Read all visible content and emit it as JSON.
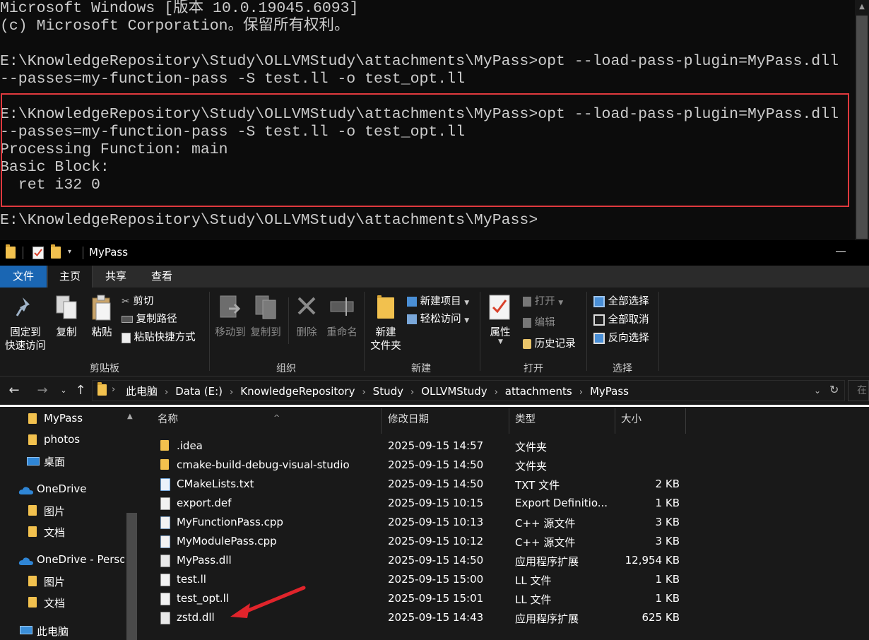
{
  "terminal": {
    "lines": [
      "Microsoft Windows [版本 10.0.19045.6093]",
      "(c) Microsoft Corporation。保留所有权利。",
      "",
      "E:\\KnowledgeRepository\\Study\\OLLVMStudy\\attachments\\MyPass>opt --load-pass-plugin=MyPass.dll",
      "--passes=my-function-pass -S test.ll -o test_opt.ll",
      "",
      "E:\\KnowledgeRepository\\Study\\OLLVMStudy\\attachments\\MyPass>opt --load-pass-plugin=MyPass.dll",
      "--passes=my-function-pass -S test.ll -o test_opt.ll",
      "Processing Function: main",
      "Basic Block:",
      "  ret i32 0",
      "",
      "E:\\KnowledgeRepository\\Study\\OLLVMStudy\\attachments\\MyPass>"
    ],
    "highlight_color": "#e0393e"
  },
  "explorer": {
    "title": "MyPass",
    "tabs": {
      "file": "文件",
      "home": "主页",
      "share": "共享",
      "view": "查看"
    },
    "ribbon": {
      "clipboard": {
        "label": "剪贴板",
        "pin_line1": "固定到",
        "pin_line2": "快速访问",
        "copy": "复制",
        "paste": "粘贴",
        "cut": "剪切",
        "copy_path": "复制路径",
        "paste_shortcut": "粘贴快捷方式"
      },
      "organize": {
        "label": "组织",
        "move_to": "移动到",
        "copy_to": "复制到",
        "delete": "删除",
        "rename": "重命名"
      },
      "new": {
        "label": "新建",
        "new_folder_line1": "新建",
        "new_folder_line2": "文件夹",
        "new_item": "新建项目",
        "easy_access": "轻松访问"
      },
      "open": {
        "label": "打开",
        "properties": "属性",
        "open": "打开",
        "edit": "编辑",
        "history": "历史记录"
      },
      "select": {
        "label": "选择",
        "select_all": "全部选择",
        "select_none": "全部取消",
        "invert": "反向选择"
      }
    },
    "breadcrumbs": [
      "此电脑",
      "Data (E:)",
      "KnowledgeRepository",
      "Study",
      "OLLVMStudy",
      "attachments",
      "MyPass"
    ],
    "search_placeholder": "在",
    "nav": [
      {
        "label": "MyPass",
        "icon": "folder-icon"
      },
      {
        "label": "photos",
        "icon": "folder-icon"
      },
      {
        "label": "桌面",
        "icon": "desktop-icon"
      },
      {
        "label": "OneDrive",
        "icon": "onedrive-icon"
      },
      {
        "label": "图片",
        "icon": "folder-icon"
      },
      {
        "label": "文档",
        "icon": "folder-icon"
      },
      {
        "label": "OneDrive - Perso",
        "icon": "onedrive-icon"
      },
      {
        "label": "图片",
        "icon": "folder-icon"
      },
      {
        "label": "文档",
        "icon": "folder-icon"
      },
      {
        "label": "此电脑",
        "icon": "computer-icon"
      }
    ],
    "columns": {
      "name": "名称",
      "modified": "修改日期",
      "type": "类型",
      "size": "大小"
    },
    "files": [
      {
        "name": ".idea",
        "modified": "2025-09-15 14:57",
        "type": "文件夹",
        "size": "",
        "icon": "folder-icon"
      },
      {
        "name": "cmake-build-debug-visual-studio",
        "modified": "2025-09-15 14:50",
        "type": "文件夹",
        "size": "",
        "icon": "folder-icon"
      },
      {
        "name": "CMakeLists.txt",
        "modified": "2025-09-15 14:50",
        "type": "TXT 文件",
        "size": "2 KB",
        "icon": "text-file-icon"
      },
      {
        "name": "export.def",
        "modified": "2025-09-15 10:15",
        "type": "Export Definitio...",
        "size": "1 KB",
        "icon": "def-file-icon"
      },
      {
        "name": "MyFunctionPass.cpp",
        "modified": "2025-09-15 10:13",
        "type": "C++ 源文件",
        "size": "3 KB",
        "icon": "cpp-file-icon"
      },
      {
        "name": "MyModulePass.cpp",
        "modified": "2025-09-15 10:12",
        "type": "C++ 源文件",
        "size": "3 KB",
        "icon": "cpp-file-icon"
      },
      {
        "name": "MyPass.dll",
        "modified": "2025-09-15 14:50",
        "type": "应用程序扩展",
        "size": "12,954 KB",
        "icon": "dll-file-icon"
      },
      {
        "name": "test.ll",
        "modified": "2025-09-15 15:00",
        "type": "LL 文件",
        "size": "1 KB",
        "icon": "file-icon"
      },
      {
        "name": "test_opt.ll",
        "modified": "2025-09-15 15:01",
        "type": "LL 文件",
        "size": "1 KB",
        "icon": "file-icon"
      },
      {
        "name": "zstd.dll",
        "modified": "2025-09-15 14:43",
        "type": "应用程序扩展",
        "size": "625 KB",
        "icon": "dll-file-icon"
      }
    ],
    "annotation_arrow_color": "#e0242b"
  }
}
